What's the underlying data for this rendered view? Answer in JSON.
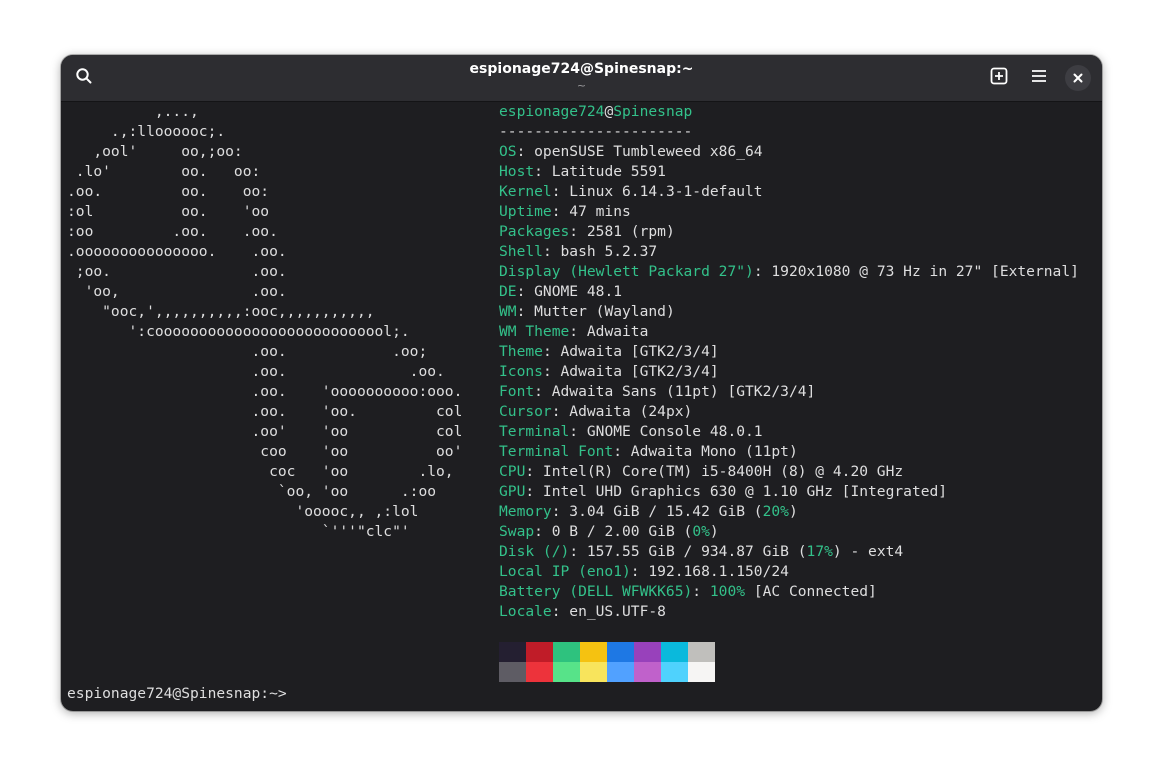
{
  "window": {
    "title": "espionage724@Spinesnap:~",
    "subtitle": "~"
  },
  "titlebar_buttons": [
    {
      "name": "search-icon"
    },
    {
      "name": "new-tab-icon"
    },
    {
      "name": "menu-icon"
    },
    {
      "name": "close-icon"
    }
  ],
  "colors": {
    "accent_green": "#33c18a",
    "text": "#dededf",
    "background": "#1e1e21",
    "titlebar": "#2d2d31"
  },
  "logo_lines": [
    "          ,...,",
    "     .,:lloooooc;.",
    "   ,ool'     oo,;oo:",
    " .lo'        oo.   oo:",
    ".oo.         oo.    oo:",
    ":ol          oo.    'oo",
    ":oo         .oo.    .oo.",
    ".ooooooooooooooo.    .oo.",
    " ;oo.                .oo.",
    "  'oo,               .oo.",
    "    \"ooc,',,,,,,,,,,:ooc,,,,,,,,,,,",
    "       ':cooooooooooooooooooooooooool;.",
    "                     .oo.            .oo;",
    "                     .oo.              .oo.",
    "                     .oo.    'oooooooooo:ooo.",
    "                     .oo.    'oo.         col",
    "                     .oo'    'oo          col",
    "                      coo    'oo          oo'",
    "                       coc   'oo        .lo,",
    "                        `oo, 'oo      .:oo",
    "                          'ooooc,, ,:lol",
    "                             `'''\"clc\"'"
  ],
  "info_header": {
    "user": "espionage724",
    "at": "@",
    "host": "Spinesnap",
    "separator": "----------------------"
  },
  "info_lines": [
    {
      "key": "OS",
      "value": ": openSUSE Tumbleweed x86_64"
    },
    {
      "key": "Host",
      "value": ": Latitude 5591"
    },
    {
      "key": "Kernel",
      "value": ": Linux 6.14.3-1-default"
    },
    {
      "key": "Uptime",
      "value": ": 47 mins"
    },
    {
      "key": "Packages",
      "value": ": 2581 (rpm)"
    },
    {
      "key": "Shell",
      "value": ": bash 5.2.37"
    },
    {
      "key": "Display (Hewlett Packard 27\")",
      "value": ": 1920x1080 @ 73 Hz in 27\" [External]"
    },
    {
      "key": "DE",
      "value": ": GNOME 48.1"
    },
    {
      "key": "WM",
      "value": ": Mutter (Wayland)"
    },
    {
      "key": "WM Theme",
      "value": ": Adwaita"
    },
    {
      "key": "Theme",
      "value": ": Adwaita [GTK2/3/4]"
    },
    {
      "key": "Icons",
      "value": ": Adwaita [GTK2/3/4]"
    },
    {
      "key": "Font",
      "value": ": Adwaita Sans (11pt) [GTK2/3/4]"
    },
    {
      "key": "Cursor",
      "value": ": Adwaita (24px)"
    },
    {
      "key": "Terminal",
      "value": ": GNOME Console 48.0.1"
    },
    {
      "key": "Terminal Font",
      "value": ": Adwaita Mono (11pt)"
    },
    {
      "key": "CPU",
      "value": ": Intel(R) Core(TM) i5-8400H (8) @ 4.20 GHz"
    },
    {
      "key": "GPU",
      "value": ": Intel UHD Graphics 630 @ 1.10 GHz [Integrated]"
    }
  ],
  "memory": {
    "key": "Memory",
    "value_a": ": 3.04 GiB / 15.42 GiB (",
    "pct": "20%",
    "value_b": ")"
  },
  "swap": {
    "key": "Swap",
    "value_a": ": 0 B / 2.00 GiB (",
    "pct": "0%",
    "value_b": ")"
  },
  "disk": {
    "key": "Disk (",
    "path": "/",
    "key_end": ")",
    "value_a": ": 157.55 GiB / 934.87 GiB (",
    "pct": "17%",
    "value_b": ") - ext4"
  },
  "local_ip": {
    "key": "Local IP (eno1)",
    "value": ": 192.168.1.150/24"
  },
  "battery": {
    "key": "Battery (DELL WFWKK65)",
    "colon": ": ",
    "pct": "100%",
    "value": " [AC Connected]"
  },
  "locale": {
    "key": "Locale",
    "value": ": en_US.UTF-8"
  },
  "palette": {
    "normal": [
      "#241f31",
      "#c01c28",
      "#2ec27e",
      "#f5c211",
      "#1e78e4",
      "#9841bb",
      "#0ab9dc",
      "#c0bfbc"
    ],
    "bright": [
      "#5e5c64",
      "#ed333b",
      "#57e389",
      "#f8e45c",
      "#51a1ff",
      "#c061cb",
      "#4fd2fd",
      "#f6f5f4"
    ]
  },
  "prompt": "espionage724@Spinesnap:~>"
}
